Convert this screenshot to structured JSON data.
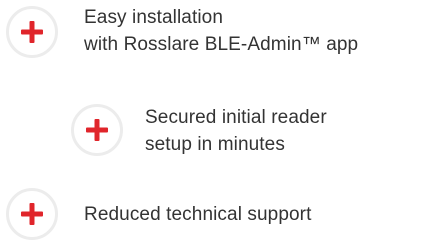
{
  "features": [
    {
      "icon": "plus-icon",
      "lines": [
        "Easy installation",
        "with Rosslare BLE-Admin™ app"
      ]
    },
    {
      "icon": "plus-icon",
      "lines": [
        "Secured initial reader",
        "setup in minutes"
      ]
    },
    {
      "icon": "plus-icon",
      "lines": [
        "Reduced technical support"
      ]
    }
  ],
  "colors": {
    "accent": "#e0252b",
    "ring": "#ececec",
    "text": "#333333"
  }
}
